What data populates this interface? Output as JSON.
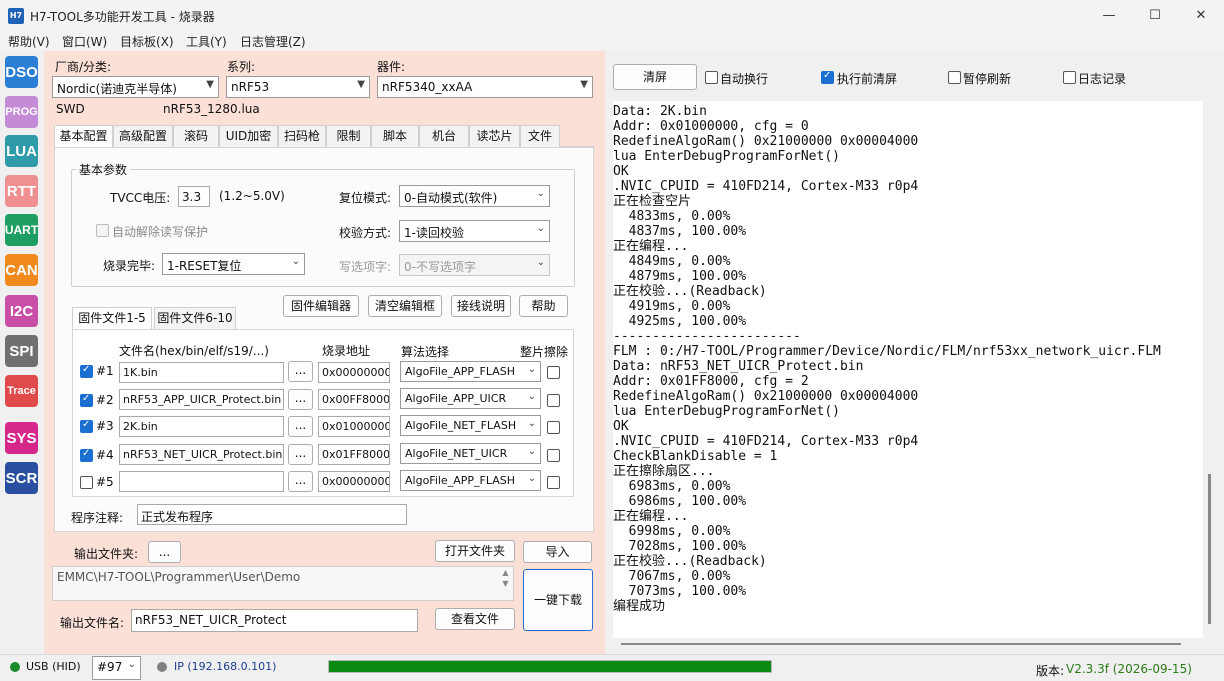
{
  "window": {
    "title": "H7-TOOL多功能开发工具 - 烧录器",
    "app_icon": "H7",
    "minimize": "—",
    "maximize": "☐",
    "close": "✕"
  },
  "menu": [
    "帮助(V)",
    "窗口(W)",
    "目标板(X)",
    "工具(Y)",
    "日志管理(Z)"
  ],
  "sidebar": [
    {
      "label": "DSO",
      "color": "#2a7fd4"
    },
    {
      "label": "PROG",
      "color": "#c68bd6"
    },
    {
      "label": "LUA",
      "color": "#2f9aa8"
    },
    {
      "label": "RTT",
      "color": "#f08f8f"
    },
    {
      "label": "UART",
      "color": "#1f9e63"
    },
    {
      "label": "CAN",
      "color": "#f08a1c"
    },
    {
      "label": "I2C",
      "color": "#c94fa6"
    },
    {
      "label": "SPI",
      "color": "#707070"
    },
    {
      "label": "Trace",
      "color": "#e14a4a"
    },
    {
      "label": "SYS",
      "color": "#d6278a"
    },
    {
      "label": "SCR",
      "color": "#2a4fa0"
    }
  ],
  "device": {
    "vendor_label": "厂商/分类:",
    "vendor_value": "Nordic(诺迪克半导体)",
    "series_label": "系列:",
    "series_value": "nRF53",
    "device_label": "器件:",
    "device_value": "nRF5340_xxAA",
    "interface": "SWD",
    "lua_file": "nRF53_1280.lua"
  },
  "tabs": [
    "基本配置",
    "高级配置",
    "滚码",
    "UID加密",
    "扫码枪",
    "限制",
    "脚本",
    "机台",
    "读芯片",
    "文件"
  ],
  "basic": {
    "group_title": "基本参数",
    "tvcc_label": "TVCC电压:",
    "tvcc_value": "3.3",
    "tvcc_range": "(1.2~5.0V)",
    "reset_label": "复位模式:",
    "reset_value": "0-自动模式(软件)",
    "auto_unlock": "自动解除读写保护",
    "verify_label": "校验方式:",
    "verify_value": "1-读回校验",
    "finish_label": "烧录完毕:",
    "finish_value": "1-RESET复位",
    "option_label": "写选项字:",
    "option_value": "0-不写选项字"
  },
  "file_tabs": [
    "固件文件1-5",
    "固件文件6-10"
  ],
  "file_buttons": [
    "固件编辑器",
    "清空编辑框",
    "接线说明",
    "帮助"
  ],
  "file_headers": {
    "name": "文件名(hex/bin/elf/s19/...)",
    "addr": "烧录地址",
    "algo": "算法选择",
    "erase": "整片擦除"
  },
  "files": [
    {
      "index": "#1",
      "checked": true,
      "name": "1K.bin",
      "addr": "0x00000000",
      "algo": "AlgoFile_APP_FLASH"
    },
    {
      "index": "#2",
      "checked": true,
      "name": "nRF53_APP_UICR_Protect.bin",
      "addr": "0x00FF8000",
      "algo": "AlgoFile_APP_UICR"
    },
    {
      "index": "#3",
      "checked": true,
      "name": "2K.bin",
      "addr": "0x01000000",
      "algo": "AlgoFile_NET_FLASH"
    },
    {
      "index": "#4",
      "checked": true,
      "name": "nRF53_NET_UICR_Protect.bin",
      "addr": "0x01FF8000",
      "algo": "AlgoFile_NET_UICR"
    },
    {
      "index": "#5",
      "checked": false,
      "name": "",
      "addr": "0x00000000",
      "algo": "AlgoFile_APP_FLASH"
    }
  ],
  "browse_label": "...",
  "note_label": "程序注释:",
  "note_value": "正式发布程序",
  "output": {
    "folder_label": "输出文件夹:",
    "folder_btn": "...",
    "open_folder": "打开文件夹",
    "import": "导入",
    "path": "EMMC\\H7-TOOL\\Programmer\\User\\Demo",
    "one_click": "一键下载",
    "filename_label": "输出文件名:",
    "filename_value": "nRF53_NET_UICR_Protect",
    "view_file": "查看文件"
  },
  "console_toolbar": {
    "clear": "清屏",
    "options": [
      {
        "label": "自动换行",
        "checked": false
      },
      {
        "label": "执行前清屏",
        "checked": true
      },
      {
        "label": "暂停刷新",
        "checked": false
      },
      {
        "label": "日志记录",
        "checked": false
      }
    ]
  },
  "console_lines": [
    "Data: 2K.bin",
    "Addr: 0x01000000, cfg = 0",
    "RedefineAlgoRam() 0x21000000 0x00004000",
    "lua EnterDebugProgramForNet()",
    "OK",
    ".NVIC_CPUID = 410FD214, Cortex-M33 r0p4",
    "正在检查空片",
    "  4833ms, 0.00%",
    "  4837ms, 100.00%",
    "正在编程...",
    "  4849ms, 0.00%",
    "  4879ms, 100.00%",
    "正在校验...(Readback)",
    "  4919ms, 0.00%",
    "  4925ms, 100.00%",
    "------------------------",
    "FLM : 0:/H7-TOOL/Programmer/Device/Nordic/FLM/nrf53xx_network_uicr.FLM",
    "Data: nRF53_NET_UICR_Protect.bin",
    "Addr: 0x01FF8000, cfg = 2",
    "RedefineAlgoRam() 0x21000000 0x00004000",
    "lua EnterDebugProgramForNet()",
    "OK",
    ".NVIC_CPUID = 410FD214, Cortex-M33 r0p4",
    "CheckBlankDisable = 1",
    "正在擦除扇区...",
    "  6983ms, 0.00%",
    "  6986ms, 100.00%",
    "正在编程...",
    "  6998ms, 0.00%",
    "  7028ms, 100.00%",
    "正在校验...(Readback)",
    "  7067ms, 0.00%",
    "  7073ms, 100.00%",
    "编程成功"
  ],
  "status": {
    "usb": "USB (HID)",
    "usb_color": "#1a8a2a",
    "port": "#97",
    "ip": "IP (192.168.0.101)",
    "ip_color": "#808080",
    "progress": 1.0,
    "progress_color": "#0a8a12",
    "version_label": "版本:",
    "version_value": "V2.3.3f (2026-09-15)"
  }
}
